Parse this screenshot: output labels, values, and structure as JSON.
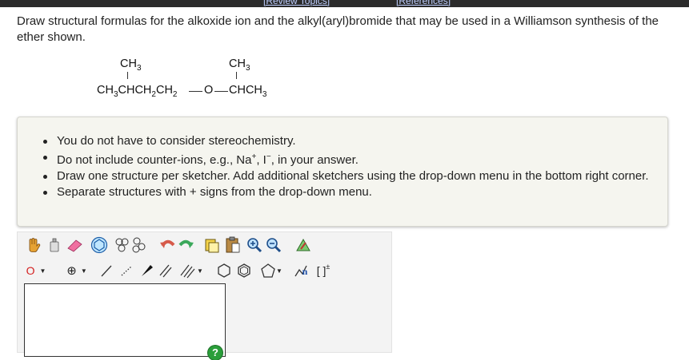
{
  "header": {
    "review_topics": "[Review Topics]",
    "references": "[References]"
  },
  "question": "Draw structural formulas for the alkoxide ion and the alkyl(aryl)bromide that may be used in a Williamson synthesis of the ether shown.",
  "structure": {
    "left_branch": "CH3",
    "right_branch": "CH3",
    "left_chain": "CH3CHCH2CH2",
    "oxygen": "O",
    "right_chain": "CHCH3"
  },
  "instructions": [
    "You do not have to consider stereochemistry.",
    "Do not include counter-ions, e.g., Na+, I-, in your answer.",
    "Draw one structure per sketcher. Add additional sketchers using the drop-down menu in the bottom right corner.",
    "Separate structures with + signs from the drop-down menu."
  ],
  "toolbar": {
    "atom_label": "O",
    "charge_label": "⊕",
    "sgroup_label": "n",
    "bracket_label": "[ ]",
    "help_label": "?"
  }
}
